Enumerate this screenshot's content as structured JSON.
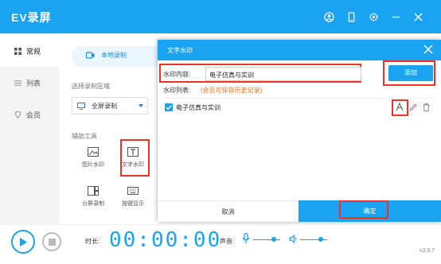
{
  "app": {
    "title": "EV录屏",
    "accent": "#1aa3f0",
    "titlebar_icons": [
      "user-icon",
      "phone-icon",
      "settings-icon",
      "minimize-icon",
      "close-icon"
    ]
  },
  "sidebar": {
    "items": [
      {
        "label": "常规",
        "icon": "grid-icon",
        "active": true
      },
      {
        "label": "列表",
        "icon": "list-icon",
        "active": false
      },
      {
        "label": "会员",
        "icon": "diamond-icon",
        "active": false
      }
    ]
  },
  "main": {
    "mode_tab": "本地录制",
    "area_label": "选择录制区域",
    "area_value": "全屏录制",
    "tools_label": "辅助工具",
    "tools": [
      {
        "label": "图片水印",
        "icon": "image-icon"
      },
      {
        "label": "文字水印",
        "icon": "text-icon"
      },
      {
        "label": "分屏录制",
        "icon": "split-screen-icon"
      },
      {
        "label": "按键显示",
        "icon": "keyboard-icon"
      }
    ]
  },
  "dialog": {
    "title": "文字水印",
    "content_label": "水印内容:",
    "content_value": "电子仿真与实训",
    "add_label": "添加",
    "list_label": "水印列表:",
    "list_hint": "(会员可保存历史记录)",
    "items": [
      {
        "text": "电子仿真与实训",
        "checked": true
      }
    ],
    "cancel_label": "取消",
    "ok_label": "确定"
  },
  "bottom": {
    "duration_label": "时长:",
    "timer": "00:00:00",
    "sound_label": "声音:",
    "mic_level": 0.75,
    "speaker_level": 0.75,
    "version": "v3.9.7"
  }
}
